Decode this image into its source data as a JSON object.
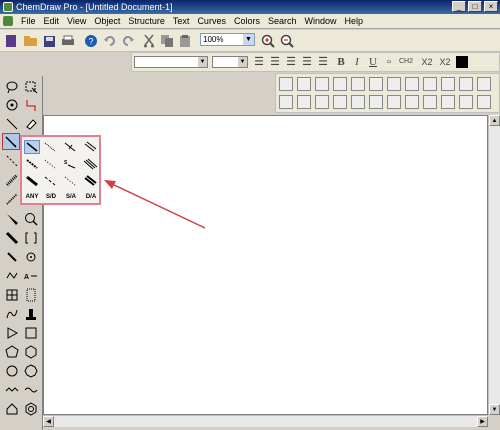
{
  "window": {
    "title": "ChemDraw Pro - [Untitled Document-1]",
    "controls": [
      "_",
      "□",
      "×"
    ]
  },
  "menu": [
    "File",
    "Edit",
    "View",
    "Object",
    "Structure",
    "Text",
    "Curves",
    "Colors",
    "Search",
    "Window",
    "Help"
  ],
  "toolbar": {
    "zoom": "100%"
  },
  "format": {
    "ch2": "CH2",
    "x2_sub": "X2",
    "x2_sup": "X2"
  },
  "flyout": {
    "labels": [
      "ANY",
      "S/D",
      "S/A",
      "D/A"
    ]
  },
  "accent": {
    "highlight": "#e08090",
    "arrow": "#d04040",
    "selection": "#b8d0ee"
  }
}
